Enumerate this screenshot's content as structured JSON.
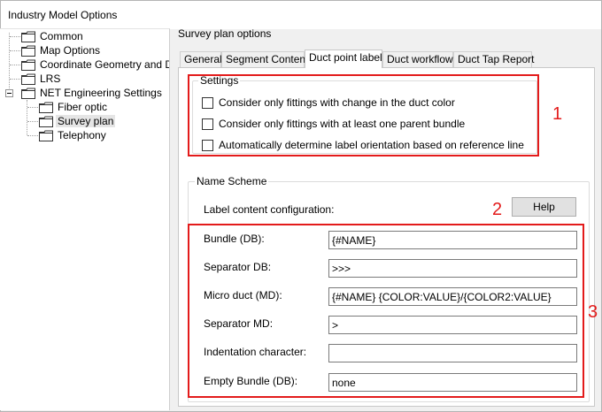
{
  "window": {
    "title": "Industry Model Options"
  },
  "tree": {
    "items": [
      {
        "label": "Common"
      },
      {
        "label": "Map Options"
      },
      {
        "label": "Coordinate Geometry and Dime"
      },
      {
        "label": "LRS"
      },
      {
        "label": "NET Engineering Settings"
      },
      {
        "label": "Fiber optic"
      },
      {
        "label": "Survey plan"
      },
      {
        "label": "Telephony"
      }
    ],
    "selected": "Survey plan"
  },
  "panel": {
    "title": "Survey plan options",
    "tabs": [
      {
        "label": "General"
      },
      {
        "label": "Segment Content"
      },
      {
        "label": "Duct point label"
      },
      {
        "label": "Duct workflow"
      },
      {
        "label": "Duct Tap Report"
      }
    ],
    "active_tab": "Duct point label"
  },
  "settings": {
    "title": "Settings",
    "checkboxes": [
      {
        "label": "Consider only fittings with change in the duct color",
        "checked": false
      },
      {
        "label": "Consider only fittings with at least one parent bundle",
        "checked": false
      },
      {
        "label": "Automatically determine label orientation based on reference line",
        "checked": false
      }
    ]
  },
  "name_scheme": {
    "title": "Name Scheme",
    "label_content": "Label content configuration:",
    "help_button": "Help",
    "fields": [
      {
        "label": "Bundle (DB):",
        "value": "{#NAME}"
      },
      {
        "label": "Separator DB:",
        "value": ">>>"
      },
      {
        "label": "Micro duct (MD):",
        "value": "{#NAME} {COLOR:VALUE}/{COLOR2:VALUE}"
      },
      {
        "label": "Separator MD:",
        "value": ">"
      },
      {
        "label": "Indentation character:",
        "value": ""
      },
      {
        "label": "Empty Bundle (DB):",
        "value": "none"
      }
    ]
  },
  "annotations": {
    "marker1": "1",
    "marker2": "2",
    "marker3": "3",
    "color": "#e31b1b"
  }
}
